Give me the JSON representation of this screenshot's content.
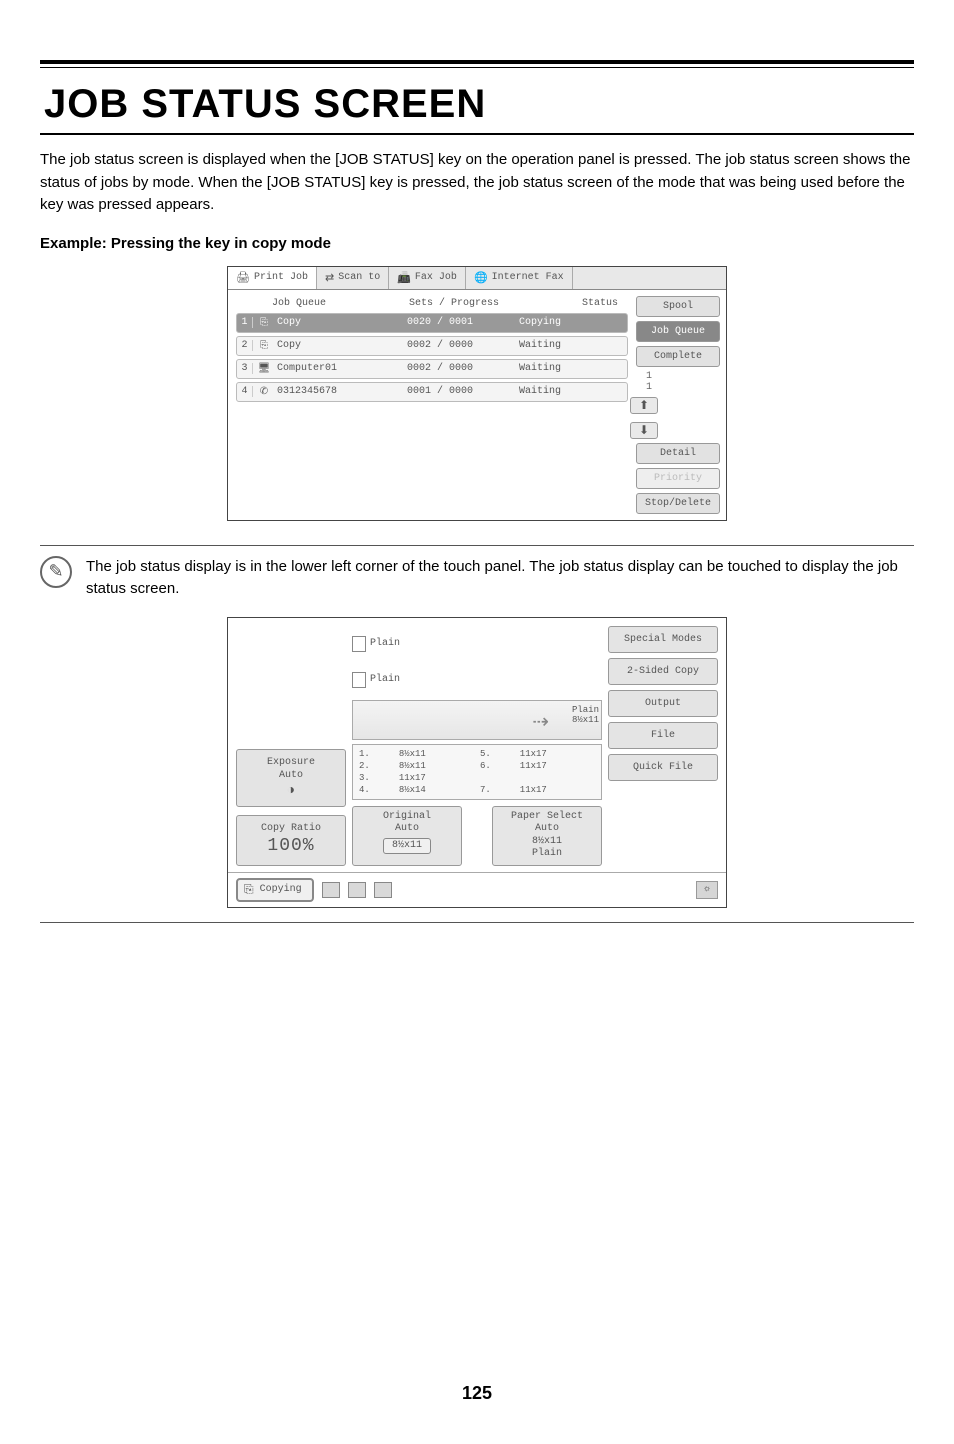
{
  "title": "JOB STATUS SCREEN",
  "intro": "The job status screen is displayed when the [JOB STATUS] key on the operation panel is pressed. The job status screen shows the status of jobs by mode. When the [JOB STATUS] key is pressed, the job status screen of the mode that was being used before the key was pressed appears.",
  "subhead": "Example: Pressing the key in copy mode",
  "screen1": {
    "tabs": {
      "print": "Print Job",
      "scan": "Scan to",
      "fax": "Fax Job",
      "ifax": "Internet Fax"
    },
    "cols": {
      "queue": "Job Queue",
      "progress": "Sets / Progress",
      "status": "Status"
    },
    "rows": [
      {
        "n": "1",
        "name": "Copy",
        "prog": "0020 / 0001",
        "status": "Copying",
        "selected": true
      },
      {
        "n": "2",
        "name": "Copy",
        "prog": "0002 / 0000",
        "status": "Waiting",
        "selected": false
      },
      {
        "n": "3",
        "name": "Computer01",
        "prog": "0002 / 0000",
        "status": "Waiting",
        "selected": false
      },
      {
        "n": "4",
        "name": "0312345678",
        "prog": "0001 / 0000",
        "status": "Waiting",
        "selected": false
      }
    ],
    "counter1": "1",
    "counter2": "1",
    "side": {
      "spool": "Spool",
      "jobqueue": "Job Queue",
      "complete": "Complete",
      "detail": "Detail",
      "priority": "Priority",
      "stopdel": "Stop/Delete"
    },
    "up": "⬆",
    "down": "⬇"
  },
  "note": "The job status display is in the lower left corner of the touch panel. The job status display can be touched to display the job status screen.",
  "screen2": {
    "left": {
      "exposure": "Exposure",
      "auto": "Auto",
      "ratioLabel": "Copy Ratio",
      "ratioValue": "100%"
    },
    "preview": {
      "plain1": "Plain",
      "plain2": "Plain",
      "sizeTag1": "Plain",
      "sizeTag2": "8½x11",
      "trays": [
        {
          "l": "8½x11",
          "r": "11x17"
        },
        {
          "l": "8½x11",
          "r": "11x17"
        },
        {
          "l": "11x17",
          "r": ""
        },
        {
          "l": "8½x14",
          "r": "11x17"
        }
      ]
    },
    "mid": {
      "originalLabel": "Original",
      "originalAuto": "Auto",
      "originalSize": "8½x11",
      "paperLabel": "Paper Select",
      "paperAuto": "Auto",
      "paperSize": "8½x11",
      "paperType": "Plain"
    },
    "right": {
      "special": "Special Modes",
      "twosided": "2-Sided Copy",
      "output": "Output",
      "file": "File",
      "quick": "Quick File"
    },
    "status": "Copying"
  },
  "pageNumber": "125"
}
